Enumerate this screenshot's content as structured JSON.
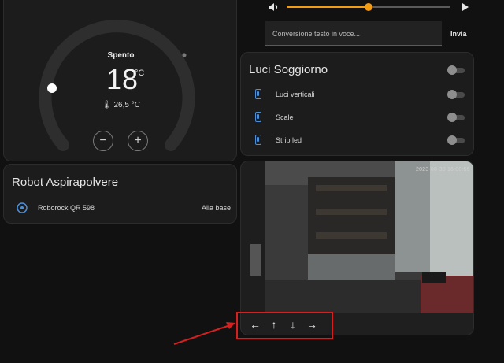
{
  "thermostat": {
    "mode": "Spento",
    "target_temp": "18",
    "unit": "°C",
    "current_temp": "26,5 °C",
    "minus_icon": "minus-icon",
    "plus_icon": "plus-icon"
  },
  "vacuum": {
    "title": "Robot Aspirapolvere",
    "device": "Roborock QR 598",
    "status": "Alla base"
  },
  "media": {
    "volume_percent": 50,
    "text_to_speech_placeholder": "Conversione testo in voce...",
    "send_label": "Invia"
  },
  "lights": {
    "title": "Luci Soggiorno",
    "items": [
      {
        "label": "Luci verticali",
        "state": "off"
      },
      {
        "label": "Scale",
        "state": "off"
      },
      {
        "label": "Strip led",
        "state": "off"
      }
    ]
  },
  "camera": {
    "timestamp": "2023-08-30 16:00:55",
    "controls": [
      "←",
      "↑",
      "↓",
      "→"
    ]
  },
  "colors": {
    "accent": "#f39c12",
    "highlight": "#d62020",
    "icon_blue": "#4a8fd8"
  }
}
